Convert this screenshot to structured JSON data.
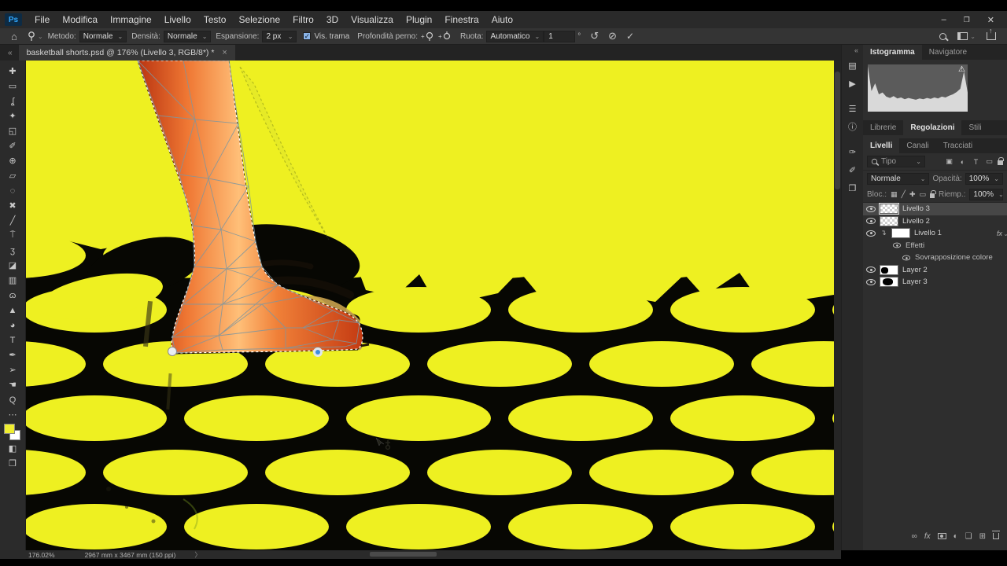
{
  "colors": {
    "canvas_yellow": "#eef021",
    "net_black": "#070703",
    "accent_blue": "#3e8ddd",
    "foreground_swatch": "#f0ee30",
    "background_swatch": "#ffffff",
    "ps_logo_blue": "#31a8ff"
  },
  "menubar": {
    "logo": "Ps",
    "items": [
      "File",
      "Modifica",
      "Immagine",
      "Livello",
      "Testo",
      "Selezione",
      "Filtro",
      "3D",
      "Visualizza",
      "Plugin",
      "Finestra",
      "Aiuto"
    ],
    "window": {
      "minimize": "–",
      "restore": "❐",
      "close": "✕"
    }
  },
  "options": {
    "metodo_label": "Metodo:",
    "metodo_value": "Normale",
    "densita_label": "Densità:",
    "densita_value": "Normale",
    "espansione_label": "Espansione:",
    "espansione_value": "2 px",
    "vis_trama_check": "✓",
    "vis_trama_label": "Vis. trama",
    "profondita_label": "Profondità perno:",
    "ruota_label": "Ruota:",
    "ruota_value": "Automatico",
    "angle_value": "1",
    "degree": "°",
    "undo_icon": "↺",
    "cancel_icon": "⊘",
    "commit_icon": "✓",
    "caret": "⌄"
  },
  "tab": {
    "title": "basketball shorts.psd @ 176% (Livello 3, RGB/8*) *",
    "close": "×",
    "chevrons": "«"
  },
  "toolbar": {
    "tools": [
      {
        "name": "move-tool-icon",
        "glyph": "✚"
      },
      {
        "name": "marquee-tool-icon",
        "glyph": "▭"
      },
      {
        "name": "lasso-tool-icon",
        "glyph": "ʆ"
      },
      {
        "name": "quick-selection-tool-icon",
        "glyph": "✦"
      },
      {
        "name": "crop-tool-icon",
        "glyph": "◱"
      },
      {
        "name": "eyedropper-tool-icon",
        "glyph": "✐"
      },
      {
        "name": "spot-healing-tool-icon",
        "glyph": "⊕"
      },
      {
        "name": "patch-tool-icon",
        "glyph": "▱"
      },
      {
        "name": "object-selection-tool-icon",
        "glyph": "◌"
      },
      {
        "name": "slice-tool-icon",
        "glyph": "✖"
      },
      {
        "name": "brush-tool-icon",
        "glyph": "╱"
      },
      {
        "name": "clone-stamp-tool-icon",
        "glyph": "⍑"
      },
      {
        "name": "history-brush-tool-icon",
        "glyph": "ʒ"
      },
      {
        "name": "eraser-tool-icon",
        "glyph": "◪"
      },
      {
        "name": "gradient-tool-icon",
        "glyph": "▥"
      },
      {
        "name": "smudge-tool-icon",
        "glyph": "ɷ"
      },
      {
        "name": "shape-tool-icon",
        "glyph": "▲"
      },
      {
        "name": "dodge-tool-icon",
        "glyph": "◕"
      },
      {
        "name": "type-tool-icon",
        "glyph": "T"
      },
      {
        "name": "pen-tool-icon",
        "glyph": "✒"
      },
      {
        "name": "path-selection-tool-icon",
        "glyph": "➢"
      },
      {
        "name": "hand-tool-icon",
        "glyph": "☚"
      },
      {
        "name": "zoom-tool-icon",
        "glyph": "Q"
      },
      {
        "name": "more-tools-icon",
        "glyph": "⋯"
      }
    ],
    "below_swatches": [
      {
        "name": "quick-mask-icon",
        "glyph": "◧"
      },
      {
        "name": "screen-mode-icon",
        "glyph": "❒"
      }
    ]
  },
  "dock": {
    "chevrons": "«",
    "icons": [
      {
        "name": "history-panel-icon",
        "glyph": "▤"
      },
      {
        "name": "actions-panel-icon",
        "glyph": "▶"
      },
      {
        "name": "properties-panel-icon",
        "glyph": "☰"
      },
      {
        "name": "info-panel-icon",
        "glyph": "ⓘ"
      },
      {
        "name": "brush-settings-panel-icon",
        "glyph": "✑"
      },
      {
        "name": "brushes-panel-icon",
        "glyph": "✐"
      },
      {
        "name": "clone-source-panel-icon",
        "glyph": "❐"
      }
    ]
  },
  "panels": {
    "top_tabs": [
      "Istogramma",
      "Navigatore"
    ],
    "mid_tabs": [
      "Librerie",
      "Regolazioni",
      "Stili"
    ],
    "layers_tabs": [
      "Livelli",
      "Canali",
      "Tracciati"
    ],
    "filter_placeholder": "Tipo",
    "filter_icons": [
      "▣",
      "◐",
      "T",
      "▭"
    ],
    "blend_value": "Normale",
    "opacity_label": "Opacità:",
    "opacity_value": "100%",
    "lock_label": "Bloc.:",
    "lock_icons": [
      "▦",
      "╱",
      "✚",
      "▭"
    ],
    "fill_label": "Riemp.:",
    "fill_value": "100%",
    "layers": [
      {
        "name": "Livello 3"
      },
      {
        "name": "Livello 2"
      },
      {
        "name": "Livello 1",
        "fx": "fx",
        "caret": "⌄",
        "clip": "↴",
        "children": [
          "Effetti",
          "Sovrapposizione colore"
        ]
      },
      {
        "name": "Layer 2"
      },
      {
        "name": "Layer 3"
      }
    ],
    "footer": {
      "link": "∞",
      "fx": "fx",
      "adjust": "◐",
      "folder": "❏",
      "new": "⊞"
    }
  },
  "histogram": {
    "warning_icon": "⚠",
    "values": [
      1.0,
      0.45,
      0.62,
      0.38,
      0.42,
      0.33,
      0.3,
      0.34,
      0.29,
      0.31,
      0.27,
      0.3,
      0.28,
      0.26,
      0.29,
      0.27,
      0.3,
      0.28,
      0.31,
      0.29,
      0.33,
      0.31,
      0.35,
      0.38,
      0.43,
      0.5,
      0.88,
      0.42
    ]
  },
  "status": {
    "zoom": "176.02%",
    "doc": "2967 mm x 3467 mm (150 ppi)",
    "arrow": "〉"
  }
}
